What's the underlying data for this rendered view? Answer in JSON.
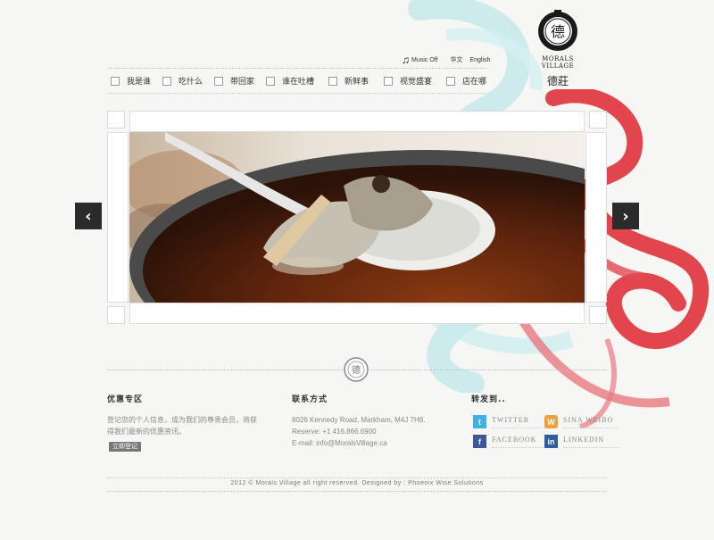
{
  "utility": {
    "music_label": "Music Off",
    "lang_cn": "华文",
    "lang_en": "English"
  },
  "logo": {
    "emblem_char": "德",
    "name": "MORALS VILLAGE",
    "name_cn": "德莊"
  },
  "nav": {
    "items": [
      {
        "label": "我是谁"
      },
      {
        "label": "吃什么"
      },
      {
        "label": "带回家"
      },
      {
        "label": "谁在吐槽"
      },
      {
        "label": "新鲜事"
      },
      {
        "label": "视觉盛宴"
      },
      {
        "label": "店在哪"
      }
    ]
  },
  "slider": {
    "prev_symbol": "‹",
    "next_symbol": "›"
  },
  "promo": {
    "title": "优惠专区",
    "text_line1": "登记您的个人信息，成为我们的尊贵会员，将获",
    "text_line2": "得我们最新的优惠资讯。",
    "button": "立即登记"
  },
  "contact": {
    "title": "联系方式",
    "address": "8026 Kennedy Road, Markham, M4J 7H8.",
    "phone": "Reserve: +1 416.866.6900",
    "email": "E-mail: info@MoralsVillage.ca"
  },
  "share": {
    "title": "转发到..",
    "twitter": "TWITTER",
    "weibo": "SINA WEIBO",
    "facebook": "FACEBOOK",
    "linkedin": "LINKEDIN"
  },
  "footer": {
    "copyright": "2012 © Morals Village all right reserved.   Designed by : Phoenix Wise Solutions"
  },
  "colors": {
    "twitter": "#3fb2e3",
    "weibo": "#e9a13a",
    "facebook": "#3b5998",
    "linkedin": "#2d5e9e"
  }
}
